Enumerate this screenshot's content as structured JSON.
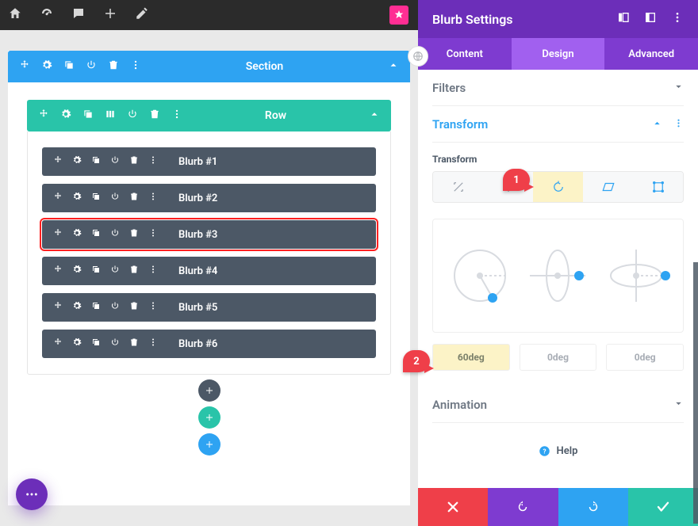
{
  "topbar": {
    "icons": [
      "home-icon",
      "gauge-icon",
      "comment-icon",
      "plus-icon",
      "pencil-icon",
      "star-icon"
    ]
  },
  "section": {
    "label": "Section"
  },
  "row": {
    "label": "Row"
  },
  "modules": [
    {
      "label": "Blurb #1",
      "selected": false
    },
    {
      "label": "Blurb #2",
      "selected": false
    },
    {
      "label": "Blurb #3",
      "selected": true
    },
    {
      "label": "Blurb #4",
      "selected": false
    },
    {
      "label": "Blurb #5",
      "selected": false
    },
    {
      "label": "Blurb #6",
      "selected": false
    }
  ],
  "panel": {
    "title": "Blurb Settings",
    "tabs": [
      {
        "label": "Content",
        "active": false
      },
      {
        "label": "Design",
        "active": true
      },
      {
        "label": "Advanced",
        "active": false
      }
    ],
    "accordions": {
      "filters": {
        "label": "Filters",
        "open": false
      },
      "transform": {
        "label": "Transform",
        "open": true
      },
      "animation": {
        "label": "Animation",
        "open": false
      }
    },
    "transform": {
      "subtitle": "Transform",
      "active_tab": "rotate",
      "degrees": [
        {
          "value": "60deg",
          "highlight": true
        },
        {
          "value": "0deg",
          "highlight": false
        },
        {
          "value": "0deg",
          "highlight": false
        }
      ]
    },
    "help_label": "Help"
  },
  "annotations": {
    "badge1": "1",
    "badge2": "2"
  }
}
